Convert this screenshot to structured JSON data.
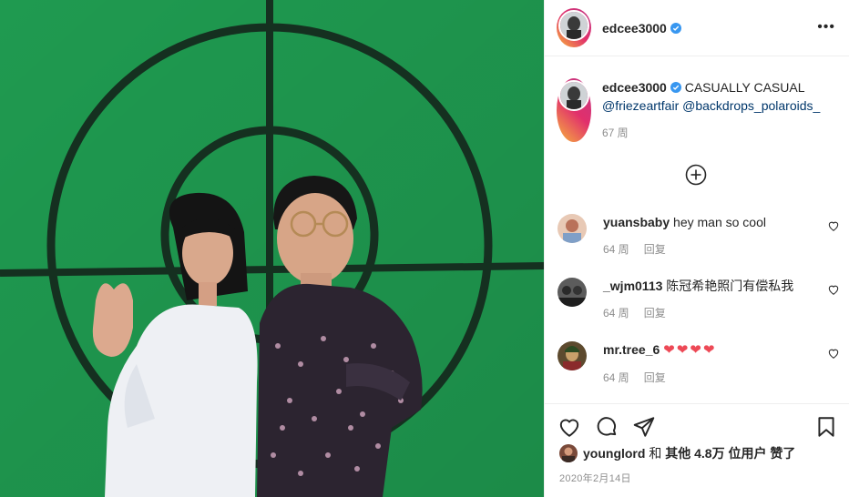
{
  "post": {
    "author": "edcee3000",
    "caption": "CASUALLY CASUAL",
    "mentions": [
      "@friezeartfair",
      "@backdrops_polaroids_"
    ],
    "caption_time": "67 周"
  },
  "comments": [
    {
      "user": "yuansbaby",
      "text": "hey man so cool",
      "time": "64 周",
      "reply": "回复",
      "avatar_color": "#c7a28f"
    },
    {
      "user": "_wjm0113",
      "text": "陈冠希艳照门有偿私我",
      "time": "64 周",
      "reply": "回复",
      "avatar_color": "#4a4a4a"
    },
    {
      "user": "mr.tree_6",
      "text": "❤❤❤❤",
      "time": "64 周",
      "reply": "回复",
      "avatar_color": "#6b5a3a"
    }
  ],
  "likes": {
    "user": "younglord",
    "text_and": "和",
    "text_others": "其他",
    "count": "4.8万",
    "text_suffix": "位用户 赞了"
  },
  "date": "2020年2月14日",
  "icons": {
    "header_more": "more-icon",
    "load_more": "plus-circle-icon",
    "like": "heart-icon",
    "comment": "comment-icon",
    "share": "send-icon",
    "save": "bookmark-icon",
    "verified": "verified-badge-icon"
  },
  "colors": {
    "backdrop_green": "#1f9a50",
    "link": "#00376b",
    "verified": "#3897f0",
    "heart_red": "#ed4956"
  }
}
